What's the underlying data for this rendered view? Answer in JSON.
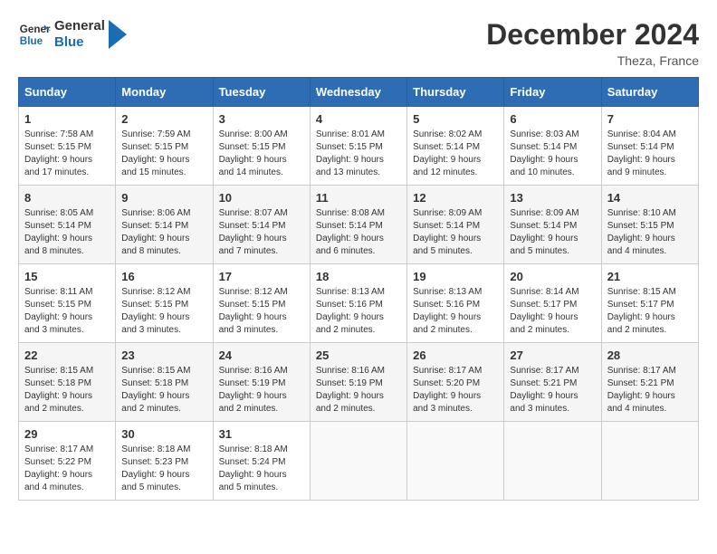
{
  "header": {
    "logo_line1": "General",
    "logo_line2": "Blue",
    "month_year": "December 2024",
    "location": "Theza, France"
  },
  "weekdays": [
    "Sunday",
    "Monday",
    "Tuesday",
    "Wednesday",
    "Thursday",
    "Friday",
    "Saturday"
  ],
  "weeks": [
    [
      {
        "day": "1",
        "sunrise": "7:58 AM",
        "sunset": "5:15 PM",
        "daylight": "9 hours and 17 minutes."
      },
      {
        "day": "2",
        "sunrise": "7:59 AM",
        "sunset": "5:15 PM",
        "daylight": "9 hours and 15 minutes."
      },
      {
        "day": "3",
        "sunrise": "8:00 AM",
        "sunset": "5:15 PM",
        "daylight": "9 hours and 14 minutes."
      },
      {
        "day": "4",
        "sunrise": "8:01 AM",
        "sunset": "5:15 PM",
        "daylight": "9 hours and 13 minutes."
      },
      {
        "day": "5",
        "sunrise": "8:02 AM",
        "sunset": "5:14 PM",
        "daylight": "9 hours and 12 minutes."
      },
      {
        "day": "6",
        "sunrise": "8:03 AM",
        "sunset": "5:14 PM",
        "daylight": "9 hours and 10 minutes."
      },
      {
        "day": "7",
        "sunrise": "8:04 AM",
        "sunset": "5:14 PM",
        "daylight": "9 hours and 9 minutes."
      }
    ],
    [
      {
        "day": "8",
        "sunrise": "8:05 AM",
        "sunset": "5:14 PM",
        "daylight": "9 hours and 8 minutes."
      },
      {
        "day": "9",
        "sunrise": "8:06 AM",
        "sunset": "5:14 PM",
        "daylight": "9 hours and 8 minutes."
      },
      {
        "day": "10",
        "sunrise": "8:07 AM",
        "sunset": "5:14 PM",
        "daylight": "9 hours and 7 minutes."
      },
      {
        "day": "11",
        "sunrise": "8:08 AM",
        "sunset": "5:14 PM",
        "daylight": "9 hours and 6 minutes."
      },
      {
        "day": "12",
        "sunrise": "8:09 AM",
        "sunset": "5:14 PM",
        "daylight": "9 hours and 5 minutes."
      },
      {
        "day": "13",
        "sunrise": "8:09 AM",
        "sunset": "5:14 PM",
        "daylight": "9 hours and 5 minutes."
      },
      {
        "day": "14",
        "sunrise": "8:10 AM",
        "sunset": "5:15 PM",
        "daylight": "9 hours and 4 minutes."
      }
    ],
    [
      {
        "day": "15",
        "sunrise": "8:11 AM",
        "sunset": "5:15 PM",
        "daylight": "9 hours and 3 minutes."
      },
      {
        "day": "16",
        "sunrise": "8:12 AM",
        "sunset": "5:15 PM",
        "daylight": "9 hours and 3 minutes."
      },
      {
        "day": "17",
        "sunrise": "8:12 AM",
        "sunset": "5:15 PM",
        "daylight": "9 hours and 3 minutes."
      },
      {
        "day": "18",
        "sunrise": "8:13 AM",
        "sunset": "5:16 PM",
        "daylight": "9 hours and 2 minutes."
      },
      {
        "day": "19",
        "sunrise": "8:13 AM",
        "sunset": "5:16 PM",
        "daylight": "9 hours and 2 minutes."
      },
      {
        "day": "20",
        "sunrise": "8:14 AM",
        "sunset": "5:17 PM",
        "daylight": "9 hours and 2 minutes."
      },
      {
        "day": "21",
        "sunrise": "8:15 AM",
        "sunset": "5:17 PM",
        "daylight": "9 hours and 2 minutes."
      }
    ],
    [
      {
        "day": "22",
        "sunrise": "8:15 AM",
        "sunset": "5:18 PM",
        "daylight": "9 hours and 2 minutes."
      },
      {
        "day": "23",
        "sunrise": "8:15 AM",
        "sunset": "5:18 PM",
        "daylight": "9 hours and 2 minutes."
      },
      {
        "day": "24",
        "sunrise": "8:16 AM",
        "sunset": "5:19 PM",
        "daylight": "9 hours and 2 minutes."
      },
      {
        "day": "25",
        "sunrise": "8:16 AM",
        "sunset": "5:19 PM",
        "daylight": "9 hours and 2 minutes."
      },
      {
        "day": "26",
        "sunrise": "8:17 AM",
        "sunset": "5:20 PM",
        "daylight": "9 hours and 3 minutes."
      },
      {
        "day": "27",
        "sunrise": "8:17 AM",
        "sunset": "5:21 PM",
        "daylight": "9 hours and 3 minutes."
      },
      {
        "day": "28",
        "sunrise": "8:17 AM",
        "sunset": "5:21 PM",
        "daylight": "9 hours and 4 minutes."
      }
    ],
    [
      {
        "day": "29",
        "sunrise": "8:17 AM",
        "sunset": "5:22 PM",
        "daylight": "9 hours and 4 minutes."
      },
      {
        "day": "30",
        "sunrise": "8:18 AM",
        "sunset": "5:23 PM",
        "daylight": "9 hours and 5 minutes."
      },
      {
        "day": "31",
        "sunrise": "8:18 AM",
        "sunset": "5:24 PM",
        "daylight": "9 hours and 5 minutes."
      },
      null,
      null,
      null,
      null
    ]
  ],
  "labels": {
    "sunrise": "Sunrise:",
    "sunset": "Sunset:",
    "daylight": "Daylight:"
  }
}
